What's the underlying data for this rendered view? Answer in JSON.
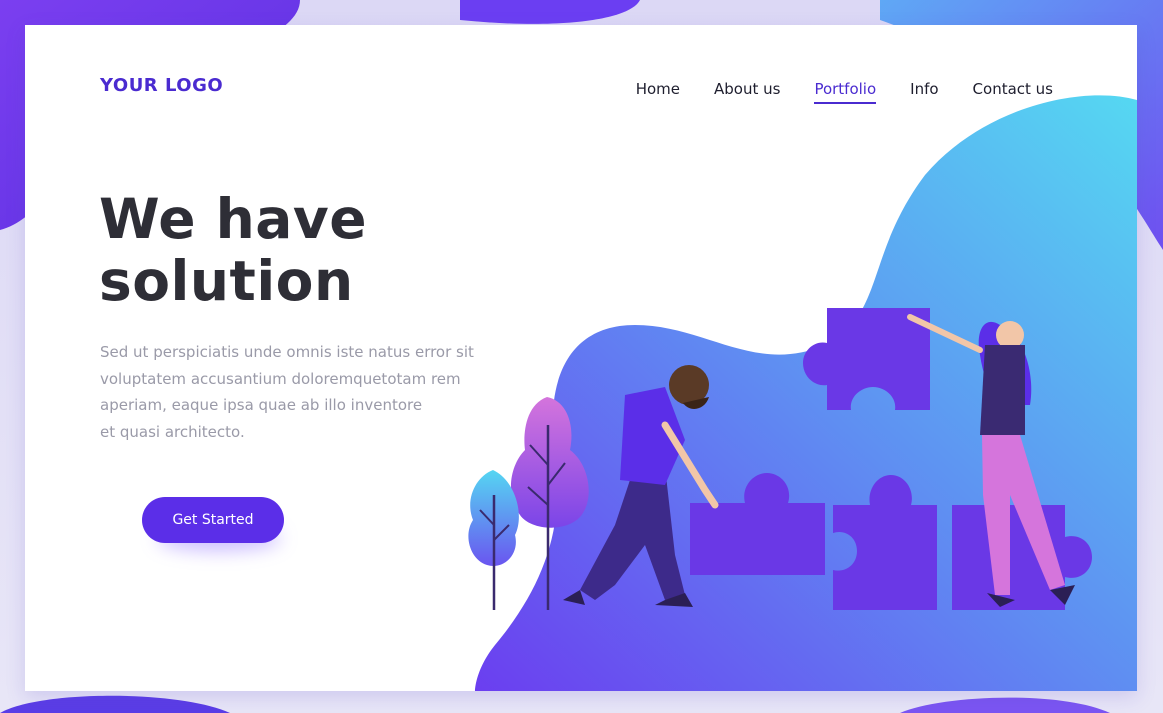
{
  "brand": {
    "logo_text": "YOUR LOGO",
    "accent_color": "#4a2bd0",
    "button_color": "#5b2ee8",
    "gradient_start": "#6a3ef0",
    "gradient_end": "#56d4f0"
  },
  "nav": {
    "items": [
      {
        "label": "Home",
        "active": false
      },
      {
        "label": "About us",
        "active": false
      },
      {
        "label": "Portfolio",
        "active": true
      },
      {
        "label": "Info",
        "active": false
      },
      {
        "label": "Contact us",
        "active": false
      }
    ]
  },
  "hero": {
    "headline_line1": "We have",
    "headline_line2": "solution",
    "body_lines": [
      "Sed ut perspiciatis unde omnis iste natus error sit",
      "voluptatem accusantium doloremquetotam rem",
      "aperiam, eaque ipsa quae ab illo inventore",
      "et quasi architecto."
    ],
    "cta_label": "Get Started"
  },
  "illustration": {
    "icons": [
      "puzzle-piece-icon",
      "man-figure-icon",
      "woman-figure-icon",
      "tree-icon"
    ]
  }
}
